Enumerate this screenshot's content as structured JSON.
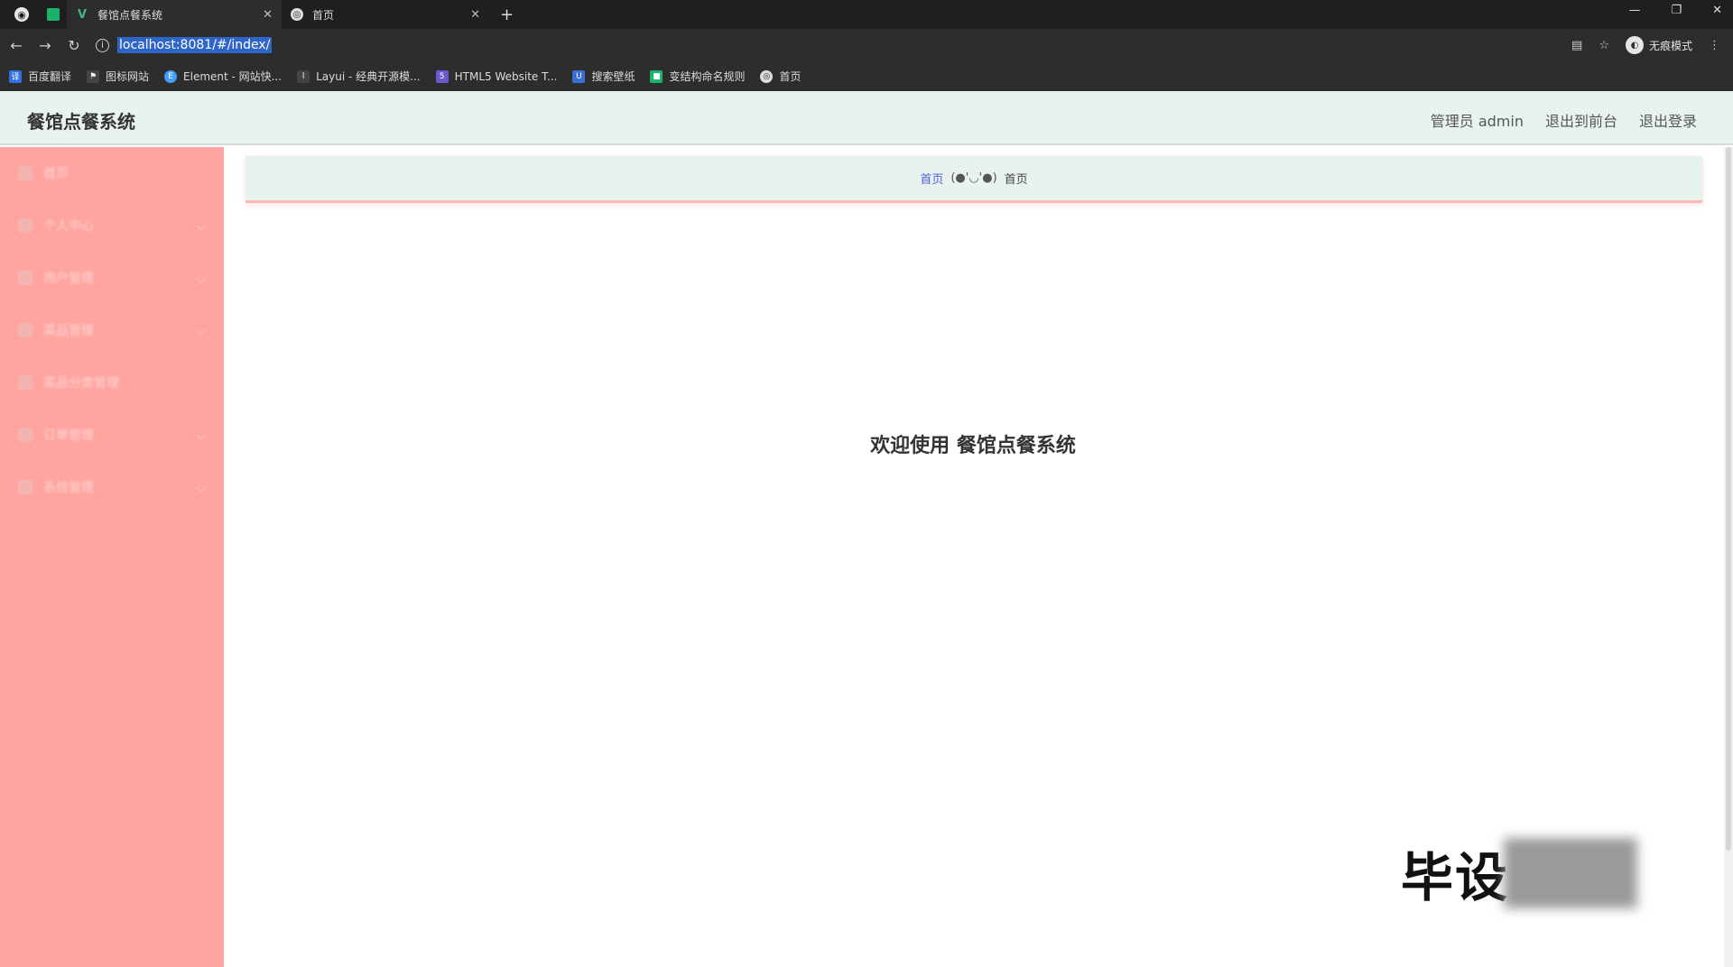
{
  "browser": {
    "tabs": [
      {
        "title": "餐馆点餐系统",
        "icon": "vue-icon",
        "active": true
      },
      {
        "title": "首页",
        "icon": "globe-icon",
        "active": false
      }
    ],
    "new_tab_symbol": "+",
    "url": "localhost:8081/#/index/",
    "incognito_label": "无痕模式",
    "bookmarks": [
      {
        "label": "百度翻译",
        "color": "#2f6fe0"
      },
      {
        "label": "图标网站",
        "color": "#444444"
      },
      {
        "label": "Element - 网站快...",
        "color": "#409eff"
      },
      {
        "label": "Layui - 经典开源模...",
        "color": "#444444"
      },
      {
        "label": "HTML5 Website T...",
        "color": "#6a5acd"
      },
      {
        "label": "搜索壁纸",
        "color": "#3b6fd6"
      },
      {
        "label": "变结构命名规则",
        "color": "#19b36b"
      },
      {
        "label": "首页",
        "color": "#dcdcdc"
      }
    ]
  },
  "app": {
    "title": "餐馆点餐系统",
    "header_links": {
      "admin": "管理员 admin",
      "back_to_front": "退出到前台",
      "logout": "退出登录"
    },
    "sidebar": {
      "items": [
        {
          "label": "首页",
          "has_arrow": false
        },
        {
          "label": "个人中心",
          "has_arrow": true
        },
        {
          "label": "用户管理",
          "has_arrow": true
        },
        {
          "label": "菜品管理",
          "has_arrow": true
        },
        {
          "label": "菜品分类管理",
          "has_arrow": false
        },
        {
          "label": "订单管理",
          "has_arrow": true
        },
        {
          "label": "系统管理",
          "has_arrow": true
        }
      ]
    },
    "breadcrumb": {
      "home": "首页",
      "separator": "(●'◡'●)",
      "current": "首页"
    },
    "welcome": "欢迎使用 餐馆点餐系统"
  },
  "watermark": {
    "text": "毕设"
  },
  "colors": {
    "sidebar_bg": "#ffa4a0",
    "header_bg": "#e9f3ee",
    "breadcrumb_link": "#4e5fd6"
  }
}
